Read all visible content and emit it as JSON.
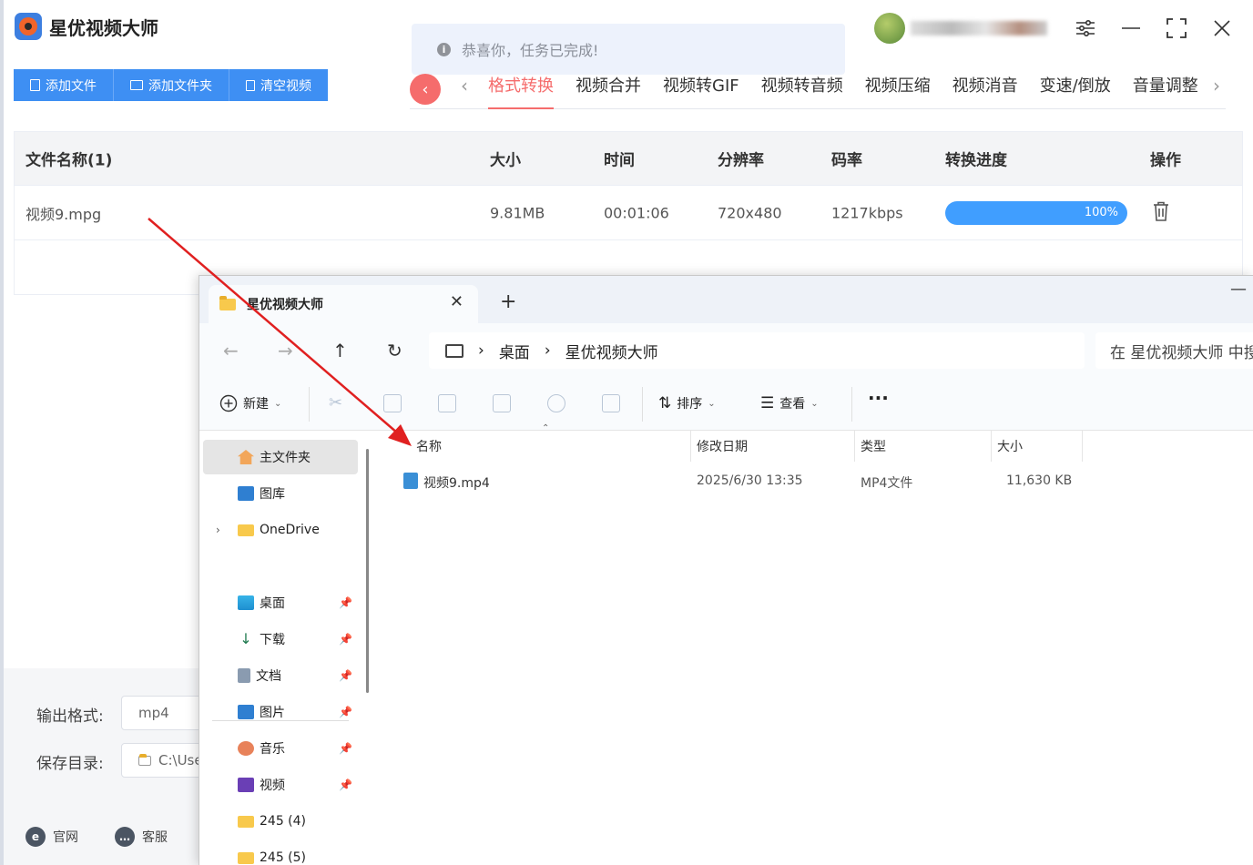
{
  "app": {
    "title": "星优视频大师",
    "toast": "恭喜你，任务已完成!",
    "toolbar": {
      "add_file": "添加文件",
      "add_folder": "添加文件夹",
      "clear": "清空视频"
    },
    "tabs": [
      "格式转换",
      "视频合并",
      "视频转GIF",
      "视频转音频",
      "视频压缩",
      "视频消音",
      "变速/倒放",
      "音量调整"
    ],
    "table": {
      "headers": {
        "name": "文件名称(1)",
        "size": "大小",
        "time": "时间",
        "resolution": "分辨率",
        "bitrate": "码率",
        "progress": "转换进度",
        "action": "操作"
      },
      "rows": [
        {
          "name": "视频9.mpg",
          "size": "9.81MB",
          "time": "00:01:06",
          "resolution": "720x480",
          "bitrate": "1217kbps",
          "progress_label": "100%",
          "progress": 1.0
        }
      ]
    },
    "output": {
      "format_label": "输出格式:",
      "format_value": "mp4",
      "dir_label": "保存目录:",
      "dir_value": "C:\\Use"
    },
    "footer": {
      "website": "官网",
      "support": "客服"
    }
  },
  "explorer": {
    "tab_title": "星优视频大师",
    "breadcrumb": [
      "桌面",
      "星优视频大师"
    ],
    "search_placeholder": "在 星优视频大师 中搜",
    "toolbar": {
      "new": "新建",
      "sort": "排序",
      "view": "查看"
    },
    "sidebar": [
      {
        "label": "主文件夹",
        "icon": "home-icon"
      },
      {
        "label": "图库",
        "icon": "gallery-icon"
      },
      {
        "label": "OneDrive",
        "icon": "folder-icon"
      },
      {
        "label": "桌面",
        "icon": "desktop-icon"
      },
      {
        "label": "下载",
        "icon": "download-icon"
      },
      {
        "label": "文档",
        "icon": "document-icon"
      },
      {
        "label": "图片",
        "icon": "pictures-icon"
      },
      {
        "label": "音乐",
        "icon": "music-icon"
      },
      {
        "label": "视频",
        "icon": "video-icon"
      },
      {
        "label": "245 (4)",
        "icon": "folder-icon"
      },
      {
        "label": "245 (5)",
        "icon": "folder-icon"
      }
    ],
    "columns": {
      "name": "名称",
      "modified": "修改日期",
      "type": "类型",
      "size": "大小"
    },
    "files": [
      {
        "name": "视频9.mp4",
        "modified": "2025/6/30 13:35",
        "type": "MP4文件",
        "size": "11,630 KB"
      }
    ]
  },
  "colors": {
    "accent_blue": "#3e8ff3",
    "accent_red": "#f56c6c",
    "progress_blue": "#409eff",
    "arrow_red": "#e02020"
  }
}
